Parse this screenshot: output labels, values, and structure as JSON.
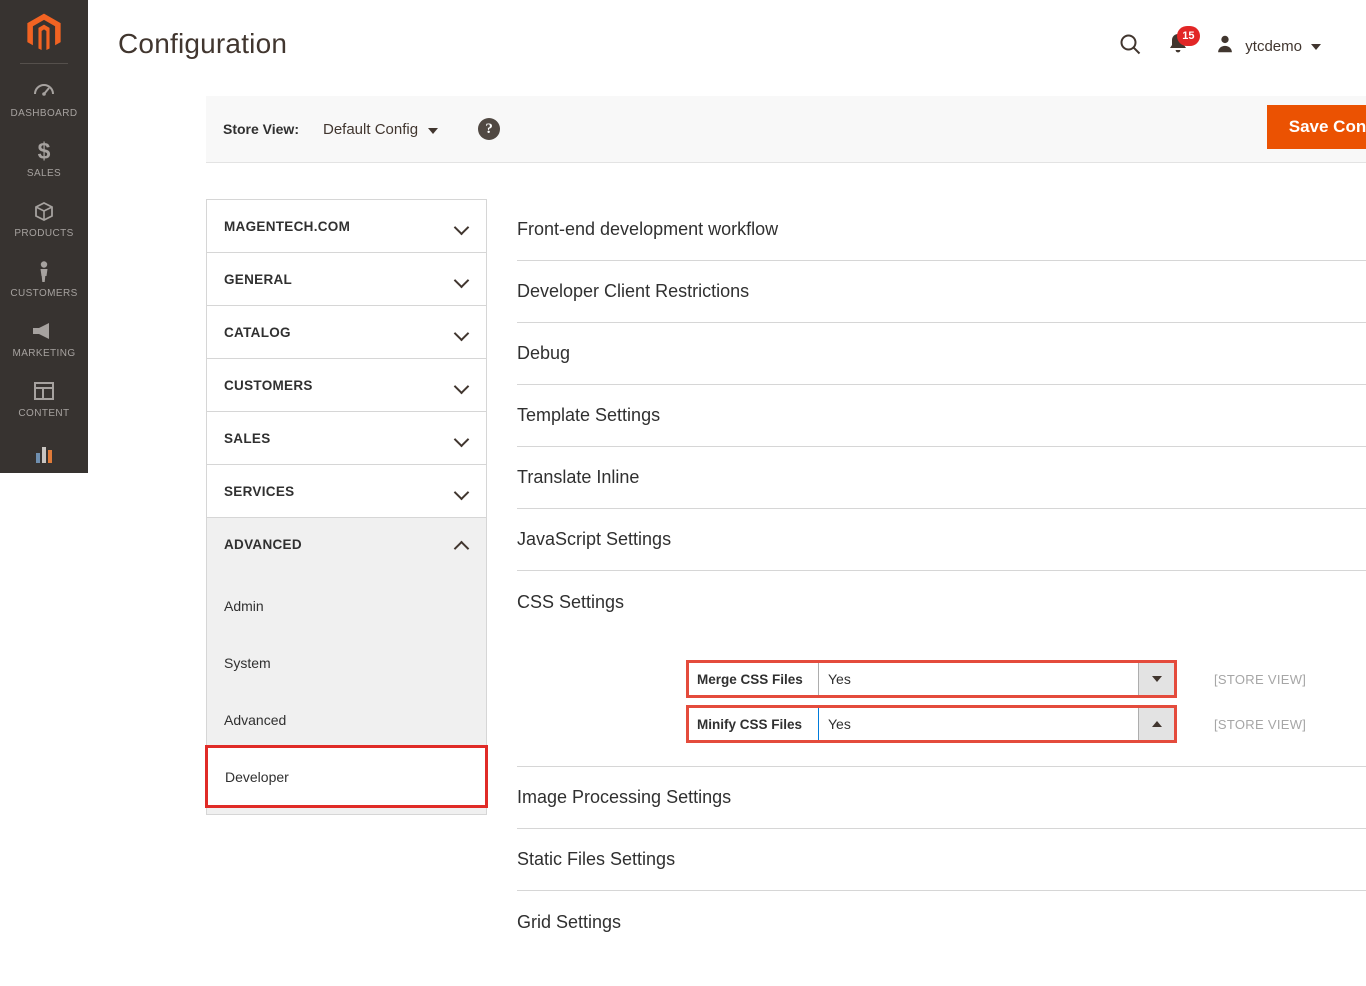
{
  "app": {
    "logo_name": "magento-logo"
  },
  "sidebar": {
    "items": [
      {
        "label": "DASHBOARD",
        "icon": "dashboard-icon"
      },
      {
        "label": "SALES",
        "icon": "dollar-icon"
      },
      {
        "label": "PRODUCTS",
        "icon": "box-icon"
      },
      {
        "label": "CUSTOMERS",
        "icon": "person-icon"
      },
      {
        "label": "MARKETING",
        "icon": "megaphone-icon"
      },
      {
        "label": "CONTENT",
        "icon": "layout-icon"
      },
      {
        "label": "",
        "icon": "reports-bar-chart-icon"
      }
    ]
  },
  "header": {
    "title": "Configuration",
    "search_icon": "search-icon",
    "notifications_icon": "bell-icon",
    "notifications_count": "15",
    "avatar_icon": "user-avatar-icon",
    "user_name": "ytcdemo"
  },
  "storeview": {
    "label": "Store View:",
    "value": "Default Config",
    "help_icon": "question-mark-icon",
    "save_label": "Save Config",
    "accent_color": "#eb5202"
  },
  "config_nav": {
    "sections": [
      {
        "label": "MAGENTECH.COM",
        "expanded": false
      },
      {
        "label": "GENERAL",
        "expanded": false
      },
      {
        "label": "CATALOG",
        "expanded": false
      },
      {
        "label": "CUSTOMERS",
        "expanded": false
      },
      {
        "label": "SALES",
        "expanded": false
      },
      {
        "label": "SERVICES",
        "expanded": false
      },
      {
        "label": "ADVANCED",
        "expanded": true
      }
    ],
    "subitems": [
      {
        "label": "Admin",
        "selected": false
      },
      {
        "label": "System",
        "selected": false
      },
      {
        "label": "Advanced",
        "selected": false
      },
      {
        "label": "Developer",
        "selected": true
      }
    ],
    "highlight_color": "#e02b27"
  },
  "content": {
    "sections": [
      {
        "label": "Front-end development workflow",
        "expanded": false
      },
      {
        "label": "Developer Client Restrictions",
        "expanded": false
      },
      {
        "label": "Debug",
        "expanded": false
      },
      {
        "label": "Template Settings",
        "expanded": false
      },
      {
        "label": "Translate Inline",
        "expanded": false
      },
      {
        "label": "JavaScript Settings",
        "expanded": false
      },
      {
        "label": "CSS Settings",
        "expanded": true
      },
      {
        "label": "Image Processing Settings",
        "expanded": false
      },
      {
        "label": "Static Files Settings",
        "expanded": false
      },
      {
        "label": "Grid Settings",
        "expanded": false
      }
    ],
    "css_settings_fields": [
      {
        "label": "Merge CSS Files",
        "value": "Yes",
        "scope": "[STORE VIEW]",
        "arrow": "triangle-down",
        "focused": false
      },
      {
        "label": "Minify CSS Files",
        "value": "Yes",
        "scope": "[STORE VIEW]",
        "arrow": "triangle-up",
        "focused": true
      }
    ],
    "field_highlight_color": "#e44b3c"
  }
}
